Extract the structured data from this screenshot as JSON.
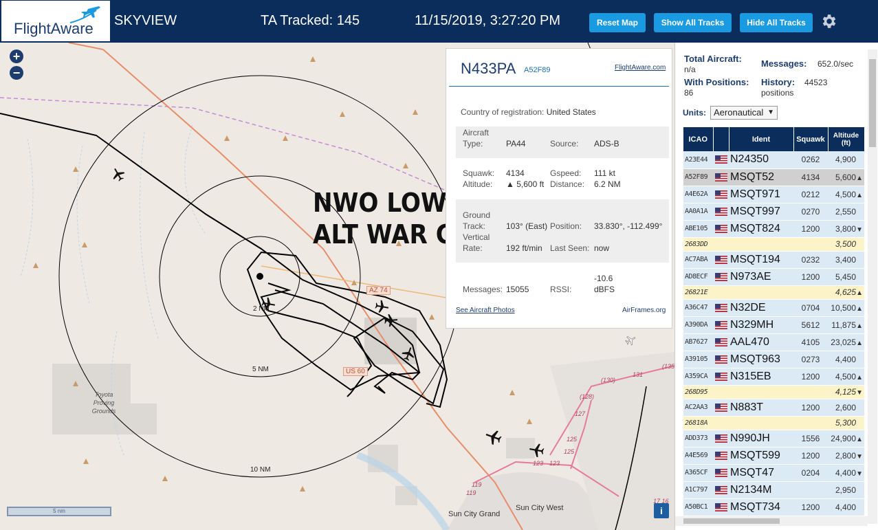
{
  "header": {
    "logo_text": "FlightAware",
    "app_title": "SKYVIEW",
    "tracked": "TA Tracked: 145",
    "datetime": "11/15/2019, 3:27:20 PM",
    "buttons": {
      "reset_map": "Reset Map",
      "show_all": "Show All Tracks",
      "hide_all": "Hide All Tracks"
    }
  },
  "map": {
    "overlay_line1": "NWO LOW",
    "overlay_line2": "ALT WAR CONT...",
    "range_labels": {
      "r2": "2 NM",
      "r5": "5 NM",
      "r10": "10 NM"
    },
    "places": {
      "proving": "Toyota\nProving\nGrounds",
      "sun_city_grand": "Sun City Grand",
      "sun_city_west": "Sun City West"
    },
    "road_shields": {
      "az74": "AZ 74",
      "us60": "US 60"
    },
    "road_numbers": [
      "(130)",
      "131",
      "(135",
      "(128)",
      "127",
      "125",
      "125",
      "123",
      "123",
      "119",
      "119",
      "17 16"
    ],
    "scale": "5 nm",
    "info": "i",
    "zoom_in": "+",
    "zoom_out": "−"
  },
  "popup": {
    "callsign": "N433PA",
    "hex": "A52F89",
    "fa_link": "FlightAware.com",
    "country_label": "Country of registration:",
    "country_value": "United States",
    "aircraft_type_label_1": "Aircraft",
    "aircraft_type_label_2": "Type:",
    "aircraft_type_value": "PA44",
    "source_label": "Source:",
    "source_value": "ADS-B",
    "squawk_label": "Squawk:",
    "squawk_value": "4134",
    "gspeed_label": "Gspeed:",
    "gspeed_value": "111 kt",
    "altitude_label": "Altitude:",
    "altitude_value": "▲ 5,600 ft",
    "distance_label": "Distance:",
    "distance_value": "6.2 NM",
    "ground_label_1": "Ground",
    "ground_label_2": "Track:",
    "ground_value": "103° (East)",
    "position_label": "Position:",
    "position_value": "33.830°, -112.499°",
    "vertical_label_1": "Vertical",
    "vertical_label_2": "Rate:",
    "vertical_value": "192 ft/min",
    "lastseen_label": "Last Seen:",
    "lastseen_value": "now",
    "messages_label": "Messages:",
    "messages_value": "15055",
    "rssi_label": "RSSI:",
    "rssi_value_1": "-10.6",
    "rssi_value_2": "dBFS",
    "photos_link": "See Aircraft Photos",
    "airframes_link": "AirFrames.org"
  },
  "panel": {
    "total_label": "Total Aircraft:",
    "total_value": "n/a",
    "messages_label": "Messages:",
    "messages_value": "652.0/sec",
    "withpos_label": "With Positions:",
    "withpos_value": "86",
    "history_label": "History:",
    "history_value": "44523",
    "history_value2": "positions",
    "units_label": "Units:",
    "units_value": "Aeronautical",
    "columns": [
      "ICAO",
      "",
      "Ident",
      "Squawk",
      "Altitude (ft)"
    ],
    "rows": [
      {
        "icao": "A23E44",
        "flag": true,
        "ident": "N24350",
        "squawk": "0262",
        "alt": "4,900",
        "trend": "",
        "kind": "row"
      },
      {
        "icao": "A52F89",
        "flag": true,
        "ident": "MSQT52",
        "squawk": "4134",
        "alt": "5,600",
        "trend": "▲",
        "kind": "row-sel"
      },
      {
        "icao": "A4E62A",
        "flag": true,
        "ident": "MSQT971",
        "squawk": "0212",
        "alt": "4,500",
        "trend": "▲",
        "kind": "row"
      },
      {
        "icao": "AA0A1A",
        "flag": true,
        "ident": "MSQT997",
        "squawk": "0270",
        "alt": "2,550",
        "trend": "",
        "kind": "row"
      },
      {
        "icao": "ABE105",
        "flag": true,
        "ident": "MSQT824",
        "squawk": "1200",
        "alt": "3,800",
        "trend": "▼",
        "kind": "row"
      },
      {
        "icao": "2683DD",
        "flag": false,
        "ident": "",
        "squawk": "",
        "alt": "3,500",
        "trend": "",
        "kind": "row-nopos"
      },
      {
        "icao": "AC7ABA",
        "flag": true,
        "ident": "MSQT194",
        "squawk": "0232",
        "alt": "3,400",
        "trend": "",
        "kind": "row"
      },
      {
        "icao": "AD8ECF",
        "flag": true,
        "ident": "N973AE",
        "squawk": "1200",
        "alt": "5,450",
        "trend": "",
        "kind": "row"
      },
      {
        "icao": "26821E",
        "flag": false,
        "ident": "",
        "squawk": "",
        "alt": "4,625",
        "trend": "▲",
        "kind": "row-nopos"
      },
      {
        "icao": "A36C47",
        "flag": true,
        "ident": "N32DE",
        "squawk": "0704",
        "alt": "10,500",
        "trend": "▲",
        "kind": "row"
      },
      {
        "icao": "A390DA",
        "flag": true,
        "ident": "N329MH",
        "squawk": "5612",
        "alt": "11,875",
        "trend": "▲",
        "kind": "row"
      },
      {
        "icao": "AB7627",
        "flag": true,
        "ident": "AAL470",
        "squawk": "4105",
        "alt": "23,025",
        "trend": "▲",
        "kind": "row"
      },
      {
        "icao": "A39105",
        "flag": true,
        "ident": "MSQT963",
        "squawk": "0273",
        "alt": "4,400",
        "trend": "",
        "kind": "row"
      },
      {
        "icao": "A359CA",
        "flag": true,
        "ident": "N315EB",
        "squawk": "1200",
        "alt": "4,500",
        "trend": "▲",
        "kind": "row"
      },
      {
        "icao": "268D95",
        "flag": false,
        "ident": "",
        "squawk": "",
        "alt": "4,125",
        "trend": "▼",
        "kind": "row-nopos"
      },
      {
        "icao": "AC2AA3",
        "flag": true,
        "ident": "N883T",
        "squawk": "1200",
        "alt": "2,600",
        "trend": "",
        "kind": "row"
      },
      {
        "icao": "26818A",
        "flag": false,
        "ident": "",
        "squawk": "",
        "alt": "5,300",
        "trend": "",
        "kind": "row-nopos"
      },
      {
        "icao": "ADD373",
        "flag": true,
        "ident": "N990JH",
        "squawk": "1556",
        "alt": "24,900",
        "trend": "▲",
        "kind": "row"
      },
      {
        "icao": "A4E569",
        "flag": true,
        "ident": "MSQT599",
        "squawk": "1200",
        "alt": "2,800",
        "trend": "▼",
        "kind": "row"
      },
      {
        "icao": "A365CF",
        "flag": true,
        "ident": "MSQT47",
        "squawk": "0204",
        "alt": "4,400",
        "trend": "▼",
        "kind": "row"
      },
      {
        "icao": "A1C797",
        "flag": true,
        "ident": "N2134M",
        "squawk": "",
        "alt": "2,950",
        "trend": "",
        "kind": "row"
      },
      {
        "icao": "A50BC1",
        "flag": true,
        "ident": "MSQT734",
        "squawk": "1200",
        "alt": "4,400",
        "trend": "",
        "kind": "row"
      }
    ]
  },
  "colors": {
    "header_bg": "#0b2d5b",
    "button_bg": "#1a9ae0",
    "map_bg": "#eeeae3",
    "table_row": "#dceaf6",
    "table_row_selected": "#d0d0d0",
    "table_row_nopos": "#fcf4c8"
  },
  "icons": {
    "logo": "flightaware-plane-icon",
    "settings": "gear-icon",
    "aircraft": "airplane-icon",
    "flag": "us-flag-icon"
  }
}
